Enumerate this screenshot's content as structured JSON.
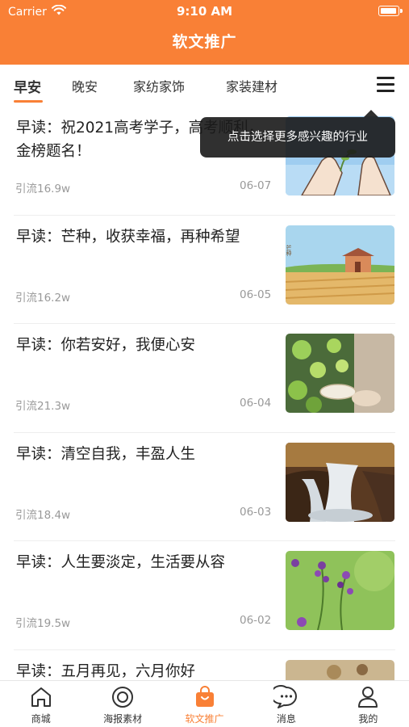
{
  "status_bar": {
    "carrier": "Carrier",
    "time": "9:10 AM"
  },
  "header": {
    "title": "软文推广"
  },
  "tabs": [
    {
      "label": "早安",
      "active": true
    },
    {
      "label": "晚安",
      "active": false
    },
    {
      "label": "家纺家饰",
      "active": false
    },
    {
      "label": "家装建材",
      "active": false
    }
  ],
  "menu_icon": "hamburger-menu-icon",
  "tooltip": {
    "text": "点击选择更多感兴趣的行业"
  },
  "articles": [
    {
      "title": "早读：祝2021高考学子，高考顺利，金榜题名！",
      "views": "引流16.9w",
      "date": "06-07",
      "thumb": "hands-with-sprout"
    },
    {
      "title": "早读：芒种，收获幸福，再种希望",
      "views": "引流16.2w",
      "date": "06-05",
      "thumb": "wheat-field-house",
      "thumb_text": "芒种"
    },
    {
      "title": "早读：你若安好，我便心安",
      "views": "引流21.3w",
      "date": "06-04",
      "thumb": "leaves-and-hat"
    },
    {
      "title": "早读：清空自我，丰盈人生",
      "views": "引流18.4w",
      "date": "06-03",
      "thumb": "waterfall"
    },
    {
      "title": "早读：人生要淡定，生活要从容",
      "views": "引流19.5w",
      "date": "06-02",
      "thumb": "purple-flowers"
    },
    {
      "title": "早读：五月再见，六月你好",
      "views": "",
      "date": "",
      "thumb": "flowers-partial"
    }
  ],
  "tabbar": [
    {
      "label": "商城",
      "icon": "home-icon",
      "active": false
    },
    {
      "label": "海报素材",
      "icon": "target-icon",
      "active": false
    },
    {
      "label": "软文推广",
      "icon": "shopping-bag-icon",
      "active": true
    },
    {
      "label": "消息",
      "icon": "chat-bubble-icon",
      "active": false
    },
    {
      "label": "我的",
      "icon": "user-icon",
      "active": false
    }
  ],
  "colors": {
    "accent": "#F98036",
    "tooltip_bg": "#191919",
    "meta_text": "#999999"
  }
}
